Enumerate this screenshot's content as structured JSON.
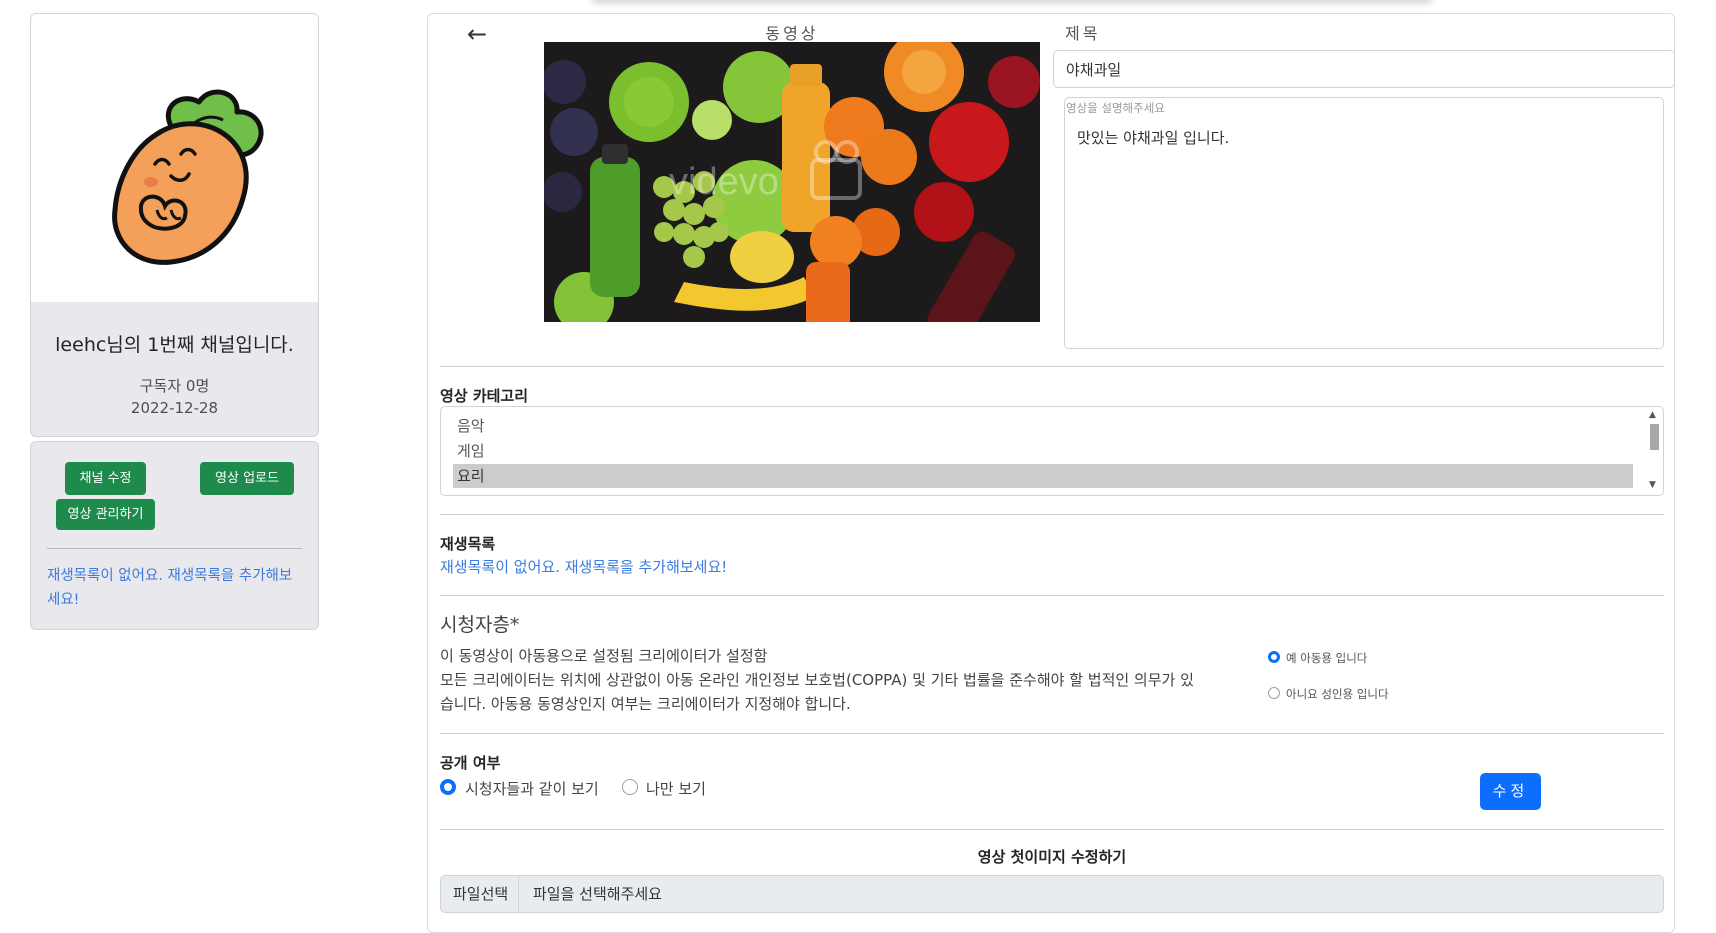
{
  "sidebar": {
    "channel_title": "leehc님의 1번째 채널입니다.",
    "subscribers": "구독자 0명",
    "created_date": "2022-12-28",
    "buttons": {
      "edit_channel": "채널 수정",
      "upload_video": "영상 업로드",
      "manage_videos": "영상 관리하기"
    },
    "empty_playlist_link": "재생목록이 없어요. 재생목록을 추가해보세요!"
  },
  "main": {
    "back_icon": "arrow-left-icon",
    "video_label": "동영상",
    "title_label": "제목",
    "title_value": "야채과일",
    "description_placeholder": "영상을 설명해주세요",
    "description_value": "맛있는 야채과일 입니다.",
    "category": {
      "label": "영상 카테고리",
      "options": [
        "음악",
        "게임",
        "요리"
      ],
      "selected": "요리"
    },
    "playlist": {
      "label": "재생목록",
      "empty_text": "재생목록이 없어요. 재생목록을 추가해보세요!"
    },
    "audience": {
      "title": "시청자층*",
      "line1": "이 동영상이 아동용으로 설정됨 크리에이터가 설정함",
      "line2": "모든 크리에이터는 위치에 상관없이 아동 온라인 개인정보 보호법(COPPA) 및 기타 법률을 준수해야 할 법적인 의무가 있",
      "line3": "습니다. 아동용 동영상인지 여부는 크리에이터가 지정해야 합니다.",
      "option_yes": "예 아동용 입니다",
      "option_no": "아니요 성인용 입니다",
      "selected": "yes"
    },
    "visibility": {
      "label": "공개 여부",
      "option_public": "시청자들과 같이 보기",
      "option_private": "나만 보기",
      "selected": "public"
    },
    "submit_button": "수정",
    "thumbnail_edit": {
      "title": "영상 첫이미지 수정하기",
      "file_button": "파일선택",
      "file_placeholder": "파일을 선택해주세요"
    }
  },
  "colors": {
    "green_button": "#1e8a4c",
    "primary_blue": "#0d6efd",
    "link_blue": "#3d7be0",
    "sidebar_bg": "#e9e8ec"
  }
}
